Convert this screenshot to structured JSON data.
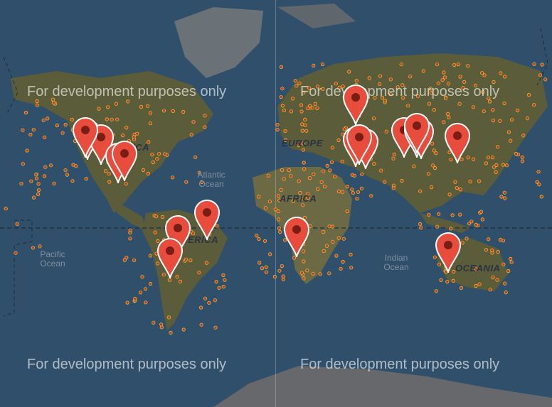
{
  "map": {
    "watermark": "For development purposes only",
    "regions": {
      "north_america": "NORTH AMERICA",
      "south_america": "SOUTH AMERICA",
      "europe": "EUROPE",
      "africa": "AFRICA",
      "oceania": "OCEANIA"
    },
    "oceans": {
      "atlantic": "Atlantic Ocean",
      "pacific": "Pacific Ocean",
      "indian": "Indian Ocean"
    },
    "colors": {
      "water": "#2f4f6b",
      "land": "#5c5c3a",
      "marker": "#e84c3d",
      "dot_fill": "#c0392b",
      "dot_outline": "#d9c331"
    },
    "marker_icon": "map-pin-icon",
    "marker_count": 19
  }
}
